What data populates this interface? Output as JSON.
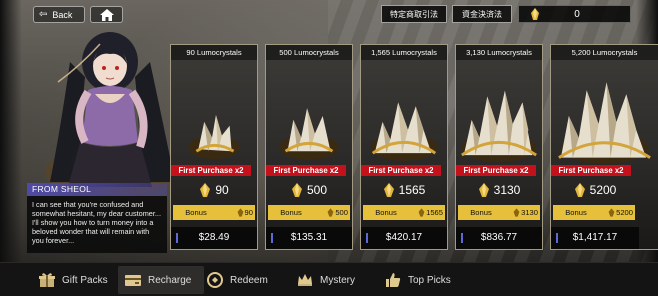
{
  "nav": {
    "back_label": "Back"
  },
  "header": {
    "legal_notice": "特定商取引法",
    "payment_act": "資金決済法",
    "currency_value": "0"
  },
  "character": {
    "name": "FROM SHEOL",
    "quote": "I can see that you're confused and somewhat hesitant, my dear customer... I'll show you how to turn money into a beloved wonder that will remain with you forever..."
  },
  "packs": [
    {
      "title": "90 Lumocrystals",
      "badge": "First Purchase x2",
      "amount": "90",
      "bonus_label": "Bonus",
      "bonus": "90",
      "price": "$28.49"
    },
    {
      "title": "500 Lumocrystals",
      "badge": "First Purchase x2",
      "amount": "500",
      "bonus_label": "Bonus",
      "bonus": "500",
      "price": "$135.31"
    },
    {
      "title": "1,565 Lumocrystals",
      "badge": "First Purchase x2",
      "amount": "1565",
      "bonus_label": "Bonus",
      "bonus": "1565",
      "price": "$420.17"
    },
    {
      "title": "3,130 Lumocrystals",
      "badge": "First Purchase x2",
      "amount": "3130",
      "bonus_label": "Bonus",
      "bonus": "3130",
      "price": "$836.77"
    },
    {
      "title": "5,200 Lumocrystals",
      "badge": "First Purchase x2",
      "amount": "5200",
      "bonus_label": "Bonus",
      "bonus": "5200",
      "price": "$1,417.17"
    }
  ],
  "tabs": {
    "gift": "Gift Packs",
    "recharge": "Recharge",
    "redeem": "Redeem",
    "mystery": "Mystery",
    "top": "Top Picks"
  },
  "colors": {
    "first_purchase_badge": "#c4111b",
    "bonus_bar": "#e6c03a",
    "name_plate": "#4f4aa6",
    "crystal_gold": "#e3b53a"
  },
  "icons": [
    "back-arrow-icon",
    "home-icon",
    "lumocrystal-icon",
    "gift-icon",
    "recharge-icon",
    "redeem-icon",
    "crown-icon",
    "thumbs-up-icon"
  ]
}
